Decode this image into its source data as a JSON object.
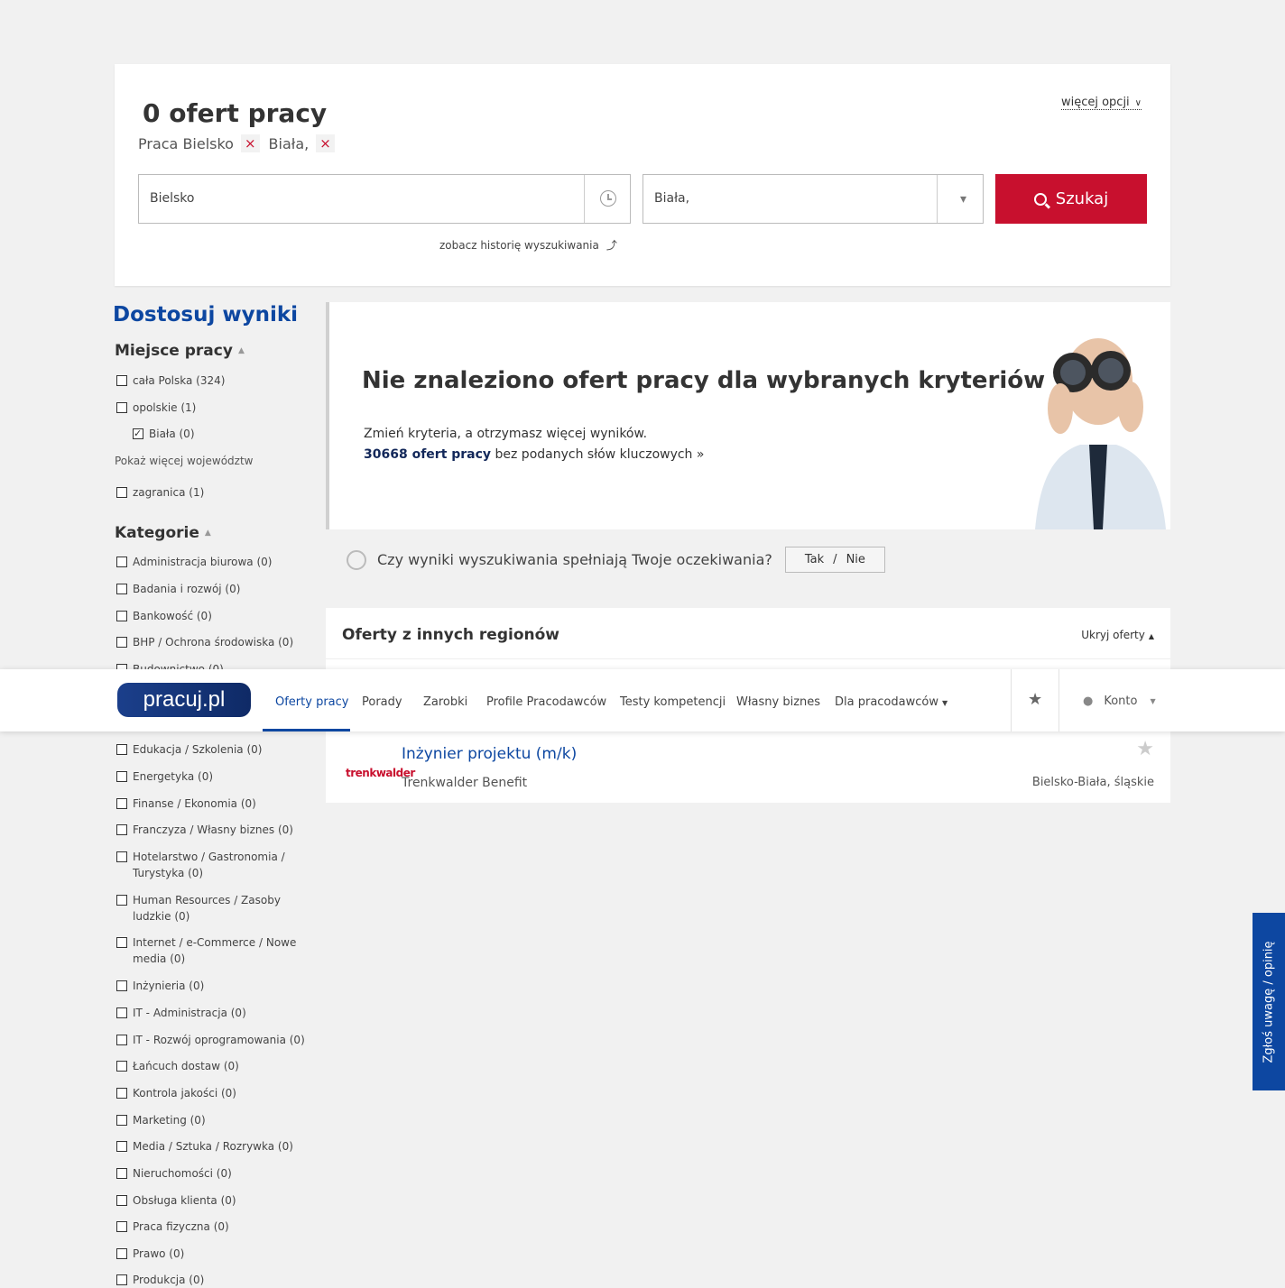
{
  "search": {
    "offers_count": "0 ofert pracy",
    "crumbs": [
      "Praca Bielsko",
      "Biała,"
    ],
    "remove_symbol": "×",
    "more_options": "więcej opcji",
    "keyword_value": "Bielsko",
    "location_value": "Biała,",
    "search_button": "Szukaj",
    "history_link": "zobacz historię wyszukiwania",
    "history_arrow": "⤴"
  },
  "sidebar": {
    "title": "Dostosuj wyniki",
    "location_heading": "Miejsce pracy",
    "location_items": [
      {
        "label": "cała Polska (324)",
        "checked": false
      },
      {
        "label": "opolskie (1)",
        "checked": false
      },
      {
        "label": "Biała (0)",
        "checked": true
      }
    ],
    "more_regions": "Pokaż więcej województw",
    "abroad": "zagranica (1)",
    "categories_heading": "Kategorie",
    "categories": [
      "Administracja biurowa (0)",
      "Badania i rozwój (0)",
      "Bankowość (0)",
      "BHP / Ochrona środowiska (0)",
      "Budownictwo (0)",
      "Edukacja / Szkolenia (0)",
      "Energetyka (0)",
      "Finanse / Ekonomia (0)",
      "Franczyza / Własny biznes (0)",
      "Hotelarstwo / Gastronomia / Turystyka (0)",
      "Human Resources / Zasoby ludzkie (0)",
      "Internet / e-Commerce / Nowe media (0)",
      "Inżynieria (0)",
      "IT - Administracja (0)",
      "IT - Rozwój oprogramowania (0)",
      "Łańcuch dostaw (0)",
      "Kontrola jakości (0)",
      "Marketing (0)",
      "Media / Sztuka / Rozrywka (0)",
      "Nieruchomości (0)",
      "Obsługa klienta (0)",
      "Praca fizyczna (0)",
      "Prawo (0)",
      "Produkcja (0)"
    ]
  },
  "no_results": {
    "title_bold": "Nie znaleziono",
    "title_rest": " ofert pracy dla wybranych kryteriów",
    "subtitle": "Zmień kryteria, a otrzymasz więcej wyników.",
    "link_bold": "30668 ofert pracy",
    "link_rest": " bez podanych słów kluczowych »"
  },
  "feedback": {
    "question": "Czy wyniki wyszukiwania spełniają Twoje oczekiwania?",
    "yes": "Tak",
    "slash": "/",
    "no": "Nie"
  },
  "other_regions": {
    "title": "Oferty z innych regionów",
    "hide": "Ukryj oferty",
    "job": {
      "logo_text": "trenkwalder",
      "title": "Inżynier projektu (m/k)",
      "company": "Trenkwalder Benefit",
      "location": "Bielsko-Biała, śląskie"
    }
  },
  "nav": {
    "logo": "pracuj.pl",
    "items": [
      "Oferty pracy",
      "Porady",
      "Zarobki",
      "Profile Pracodawców",
      "Testy kompetencji",
      "Własny biznes",
      "Dla pracodawców"
    ],
    "account": "Konto"
  },
  "feedback_tab": "Zgłoś uwagę / opinię",
  "colors": {
    "accent": "#c8102e",
    "brand_blue": "#0d47a1"
  }
}
